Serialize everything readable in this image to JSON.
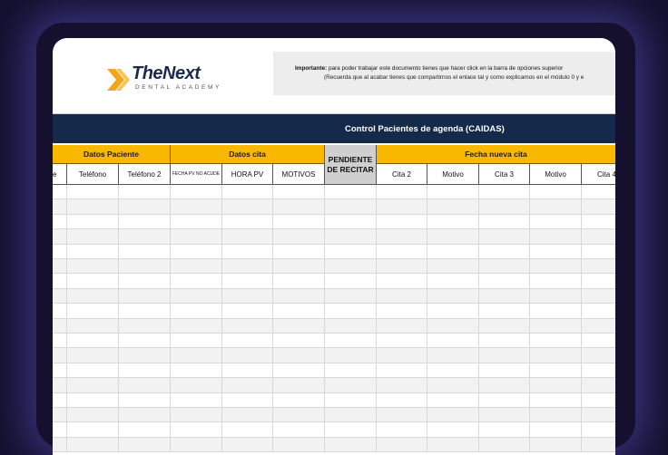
{
  "logo": {
    "title": "TheNext",
    "subtitle": "DENTAL ACADEMY"
  },
  "notice": {
    "bold": "Importante:",
    "line1": "para poder trabajar este documento tienes que hacer click en la barra de opciones superior",
    "line2": "(Recuerda que al acabar tienes que compartirnos el enlace tal y como explicamos en el módulo 0 y e"
  },
  "sheet_title": "Control Pacientes de agenda (CAIDAS)",
  "groups": {
    "datos_paciente": "Datos Paciente",
    "datos_cita": "Datos cita",
    "pendiente": "PENDIENTE DE RECITAR",
    "fecha_nueva": "Fecha nueva cita"
  },
  "columns": [
    "e",
    "Teléfono",
    "Teléfono 2",
    "FECHA PV NO ACUDE",
    "HORA PV",
    "MOTIVOS",
    "",
    "Cita 2",
    "Motivo",
    "Cita 3",
    "Motivo",
    "Cita 4"
  ],
  "colors": {
    "background": "#14102e",
    "title_bar": "#15294a",
    "header_yellow": "#f9b800",
    "pending_gray": "#cfcfcf",
    "logo_orange": "#f3a51b"
  }
}
